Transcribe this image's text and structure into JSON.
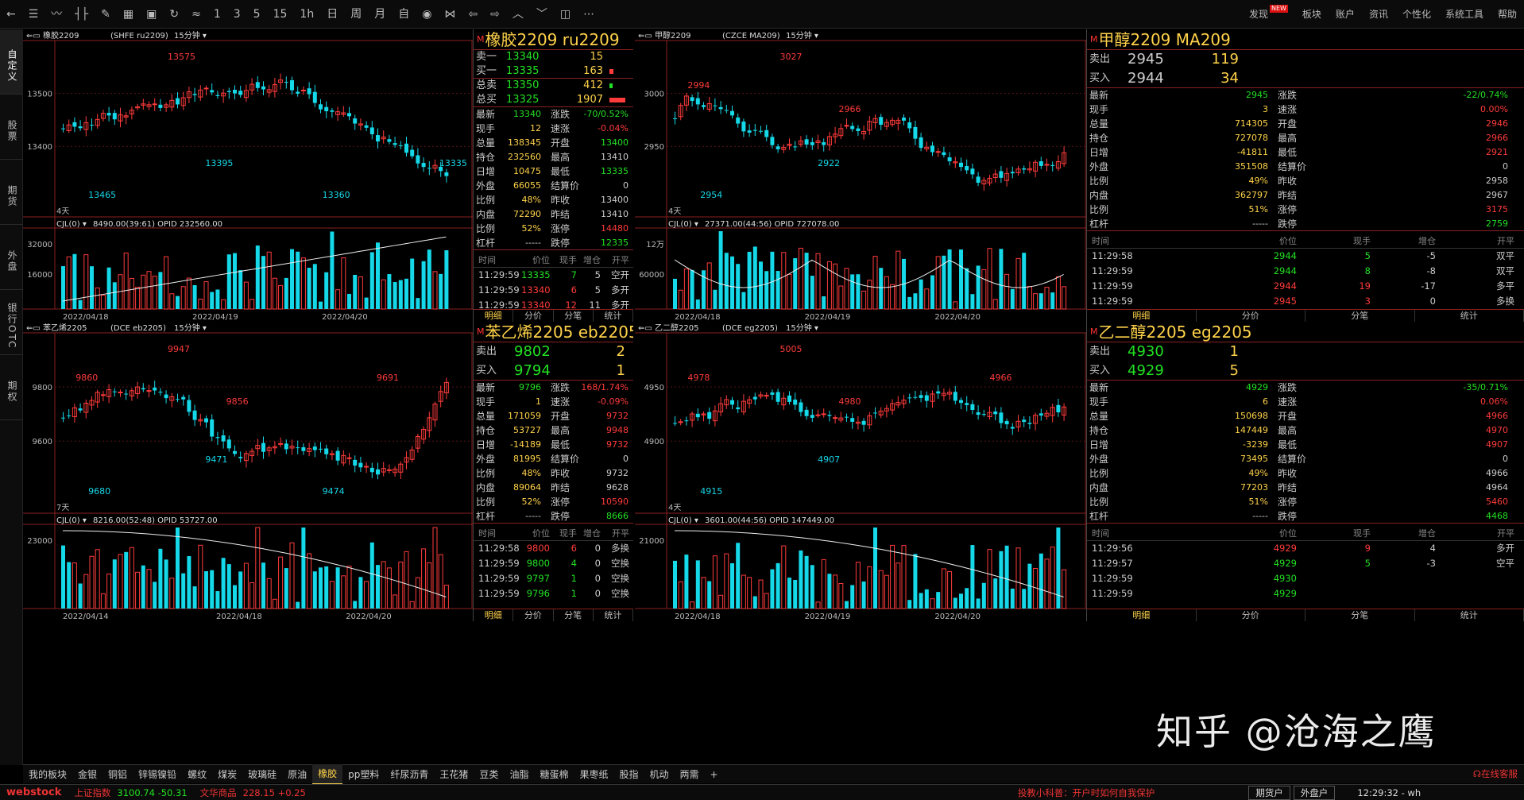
{
  "toolbar": {
    "icons": [
      "back-icon",
      "list-icon",
      "line-chart-icon",
      "candle-icon",
      "draw-icon",
      "grid-icon",
      "save-icon",
      "refresh-icon",
      "analysis-icon"
    ],
    "periods": [
      "1",
      "3",
      "5",
      "15",
      "1h",
      "日",
      "周",
      "月",
      "自"
    ],
    "right": [
      "发现",
      "板块",
      "账户",
      "资讯",
      "个性化",
      "系统工具",
      "帮助"
    ],
    "new_badge": "NEW"
  },
  "left_tabs": [
    "自定义",
    "股票",
    "期货",
    "外盘",
    "银行OTC",
    "期权"
  ],
  "panels": [
    {
      "chart_title": "橡胶2209",
      "chart_code": "(SHFE ru2209)",
      "period": "15分钟",
      "y_ticks": [
        "13500",
        "13400"
      ],
      "high_label": "13575",
      "low_labels": [
        "13465",
        "13395",
        "13360",
        "13335"
      ],
      "days": "4天",
      "vol_header": "CJL(0)",
      "vol_info": "8490.00(39:61)  OPID 232560.00",
      "vol_ticks": [
        "32000",
        "16000"
      ],
      "dates": [
        "2022/04/18",
        "2022/04/19",
        "2022/04/20"
      ],
      "quote": {
        "title": "橡胶2209  ru2209",
        "top_rows": [
          [
            "卖一",
            "13340",
            "15"
          ],
          [
            "买一",
            "13335",
            "163"
          ],
          [
            "总卖",
            "13350",
            "412"
          ],
          [
            "总买",
            "13325",
            "1907"
          ]
        ],
        "rows": [
          [
            "最新",
            "13340",
            "涨跌",
            "-70/0.52%"
          ],
          [
            "现手",
            "12",
            "速涨",
            "-0.04%"
          ],
          [
            "总量",
            "138345",
            "开盘",
            "13400"
          ],
          [
            "持仓",
            "232560",
            "最高",
            "13410"
          ],
          [
            "日增",
            "10475",
            "最低",
            "13335"
          ],
          [
            "外盘",
            "66055",
            "结算价",
            "0"
          ],
          [
            "比例",
            "48%",
            "昨收",
            "13400"
          ],
          [
            "内盘",
            "72290",
            "昨结",
            "13410"
          ],
          [
            "比例",
            "52%",
            "涨停",
            "14480"
          ],
          [
            "杠杆",
            "-----",
            "跌停",
            "12335"
          ]
        ],
        "tick_head": [
          "时间",
          "价位",
          "现手",
          "增仓",
          "开平"
        ],
        "ticks": [
          [
            "11:29:59",
            "13335",
            "7",
            "5",
            "空开"
          ],
          [
            "11:29:59",
            "13340",
            "6",
            "5",
            "多开"
          ],
          [
            "11:29:59",
            "13340",
            "12",
            "11",
            "多开"
          ]
        ],
        "tabs": [
          "明细",
          "分价",
          "分笔",
          "统计"
        ]
      }
    },
    {
      "chart_title": "甲醇2209",
      "chart_code": "(CZCE MA209)",
      "period": "15分钟",
      "y_ticks": [
        "3000",
        "2950"
      ],
      "high_label": "3027",
      "mid_labels": [
        "2994",
        "2966"
      ],
      "low_labels": [
        "2954",
        "2922"
      ],
      "days": "4天",
      "vol_header": "CJL(0)",
      "vol_info": "27371.00(44:56)  OPID 727078.00",
      "vol_ticks": [
        "12万",
        "60000"
      ],
      "dates": [
        "2022/04/18",
        "2022/04/19",
        "2022/04/20"
      ],
      "quote": {
        "title": "甲醇2209  MA209",
        "big_rows": [
          [
            "卖出",
            "2945",
            "119"
          ],
          [
            "买入",
            "2944",
            "34"
          ]
        ],
        "rows": [
          [
            "最新",
            "2945",
            "涨跌",
            "-22/0.74%"
          ],
          [
            "现手",
            "3",
            "速涨",
            "0.00%"
          ],
          [
            "总量",
            "714305",
            "开盘",
            "2946"
          ],
          [
            "持仓",
            "727078",
            "最高",
            "2966"
          ],
          [
            "日增",
            "-41811",
            "最低",
            "2921"
          ],
          [
            "外盘",
            "351508",
            "结算价",
            "0"
          ],
          [
            "比例",
            "49%",
            "昨收",
            "2958"
          ],
          [
            "内盘",
            "362797",
            "昨结",
            "2967"
          ],
          [
            "比例",
            "51%",
            "涨停",
            "3175"
          ],
          [
            "杠杆",
            "-----",
            "跌停",
            "2759"
          ]
        ],
        "tick_head": [
          "时间",
          "价位",
          "现手",
          "增仓",
          "开平"
        ],
        "ticks": [
          [
            "11:29:58",
            "2944",
            "5",
            "-5",
            "双平"
          ],
          [
            "11:29:59",
            "2944",
            "8",
            "-8",
            "双平"
          ],
          [
            "11:29:59",
            "2944",
            "19",
            "-17",
            "多平"
          ],
          [
            "11:29:59",
            "2945",
            "3",
            "0",
            "多换"
          ]
        ],
        "tabs": [
          "明细",
          "分价",
          "分笔",
          "统计"
        ]
      }
    },
    {
      "chart_title": "苯乙烯2205",
      "chart_code": "(DCE eb2205)",
      "period": "15分钟",
      "y_ticks": [
        "9800",
        "9600"
      ],
      "high_label": "9947",
      "mid_labels": [
        "9860",
        "9856",
        "9691"
      ],
      "low_labels": [
        "9680",
        "9471",
        "9474"
      ],
      "days": "7天",
      "vol_header": "CJL(0)",
      "vol_info": "8216.00(52:48)  OPID 53727.00",
      "vol_ticks": [
        "23000"
      ],
      "dates": [
        "2022/04/14",
        "2022/04/18",
        "2022/04/20"
      ],
      "quote": {
        "title": "苯乙烯2205  eb2205",
        "big_rows": [
          [
            "卖出",
            "9802",
            "2"
          ],
          [
            "买入",
            "9794",
            "1"
          ]
        ],
        "rows": [
          [
            "最新",
            "9796",
            "涨跌",
            "168/1.74%"
          ],
          [
            "现手",
            "1",
            "速涨",
            "-0.09%"
          ],
          [
            "总量",
            "171059",
            "开盘",
            "9732"
          ],
          [
            "持仓",
            "53727",
            "最高",
            "9948"
          ],
          [
            "日增",
            "-14189",
            "最低",
            "9732"
          ],
          [
            "外盘",
            "81995",
            "结算价",
            "0"
          ],
          [
            "比例",
            "48%",
            "昨收",
            "9732"
          ],
          [
            "内盘",
            "89064",
            "昨结",
            "9628"
          ],
          [
            "比例",
            "52%",
            "涨停",
            "10590"
          ],
          [
            "杠杆",
            "-----",
            "跌停",
            "8666"
          ]
        ],
        "tick_head": [
          "时间",
          "价位",
          "现手",
          "增仓",
          "开平"
        ],
        "ticks": [
          [
            "11:29:58",
            "9800",
            "6",
            "0",
            "多换"
          ],
          [
            "11:29:59",
            "9800",
            "4",
            "0",
            "空换"
          ],
          [
            "11:29:59",
            "9797",
            "1",
            "0",
            "空换"
          ],
          [
            "11:29:59",
            "9796",
            "1",
            "0",
            "空换"
          ]
        ],
        "tabs": [
          "明细",
          "分价",
          "分笔",
          "统计"
        ]
      }
    },
    {
      "chart_title": "乙二醇2205",
      "chart_code": "(DCE eg2205)",
      "period": "15分钟",
      "y_ticks": [
        "4950",
        "4900"
      ],
      "high_label": "5005",
      "mid_labels": [
        "4978",
        "4980",
        "4966"
      ],
      "low_labels": [
        "4915",
        "4907"
      ],
      "days": "4天",
      "vol_header": "CJL(0)",
      "vol_info": "3601.00(44:56)  OPID 147449.00",
      "vol_ticks": [
        "21000"
      ],
      "dates": [
        "2022/04/18",
        "2022/04/19",
        "2022/04/20"
      ],
      "quote": {
        "title": "乙二醇2205  eg2205",
        "big_rows": [
          [
            "卖出",
            "4930",
            "1"
          ],
          [
            "买入",
            "4929",
            "5"
          ]
        ],
        "rows": [
          [
            "最新",
            "4929",
            "涨跌",
            "-35/0.71%"
          ],
          [
            "现手",
            "6",
            "速涨",
            "0.06%"
          ],
          [
            "总量",
            "150698",
            "开盘",
            "4966"
          ],
          [
            "持仓",
            "147449",
            "最高",
            "4970"
          ],
          [
            "日增",
            "-3239",
            "最低",
            "4907"
          ],
          [
            "外盘",
            "73495",
            "结算价",
            "0"
          ],
          [
            "比例",
            "49%",
            "昨收",
            "4966"
          ],
          [
            "内盘",
            "77203",
            "昨结",
            "4964"
          ],
          [
            "比例",
            "51%",
            "涨停",
            "5460"
          ],
          [
            "杠杆",
            "-----",
            "跌停",
            "4468"
          ]
        ],
        "tick_head": [
          "时间",
          "价位",
          "现手",
          "增仓",
          "开平"
        ],
        "ticks": [
          [
            "11:29:56",
            "4929",
            "9",
            "4",
            "多开"
          ],
          [
            "11:29:57",
            "4929",
            "5",
            "-3",
            "空平"
          ],
          [
            "11:29:59",
            "4930",
            "",
            "",
            ""
          ],
          [
            "11:29:59",
            "4929",
            "",
            "",
            ""
          ]
        ],
        "tabs": [
          "明细",
          "分价",
          "分笔",
          "统计"
        ]
      }
    }
  ],
  "bottom_tabs": [
    "我的板块",
    "金银",
    "铜铝",
    "锌锡镍铅",
    "螺纹",
    "煤炭",
    "玻璃硅",
    "原油",
    "橡胶",
    "pp塑料",
    "纤尿沥青",
    "王花猪",
    "豆类",
    "油脂",
    "糖蛋棉",
    "果枣纸",
    "股指",
    "机动",
    "两需",
    "+"
  ],
  "active_bottom_tab": "橡胶",
  "status": {
    "brand": "webstock",
    "index1_name": "上证指数",
    "index1_val": "3100.74  -50.31",
    "index2_name": "文华商品",
    "index2_val": "228.15  +0.25",
    "tip": "投教小科普：开户时如何自我保护",
    "btn1": "期货户",
    "btn2": "外盘户",
    "time": "12:29:32 - wh",
    "online": "在线客服"
  },
  "watermark": "知乎 @沧海之鹰",
  "colors": {
    "up": "#ff3b3b",
    "down": "#15d8e8",
    "accent": "#ffd24a",
    "grid": "#8a2020"
  }
}
